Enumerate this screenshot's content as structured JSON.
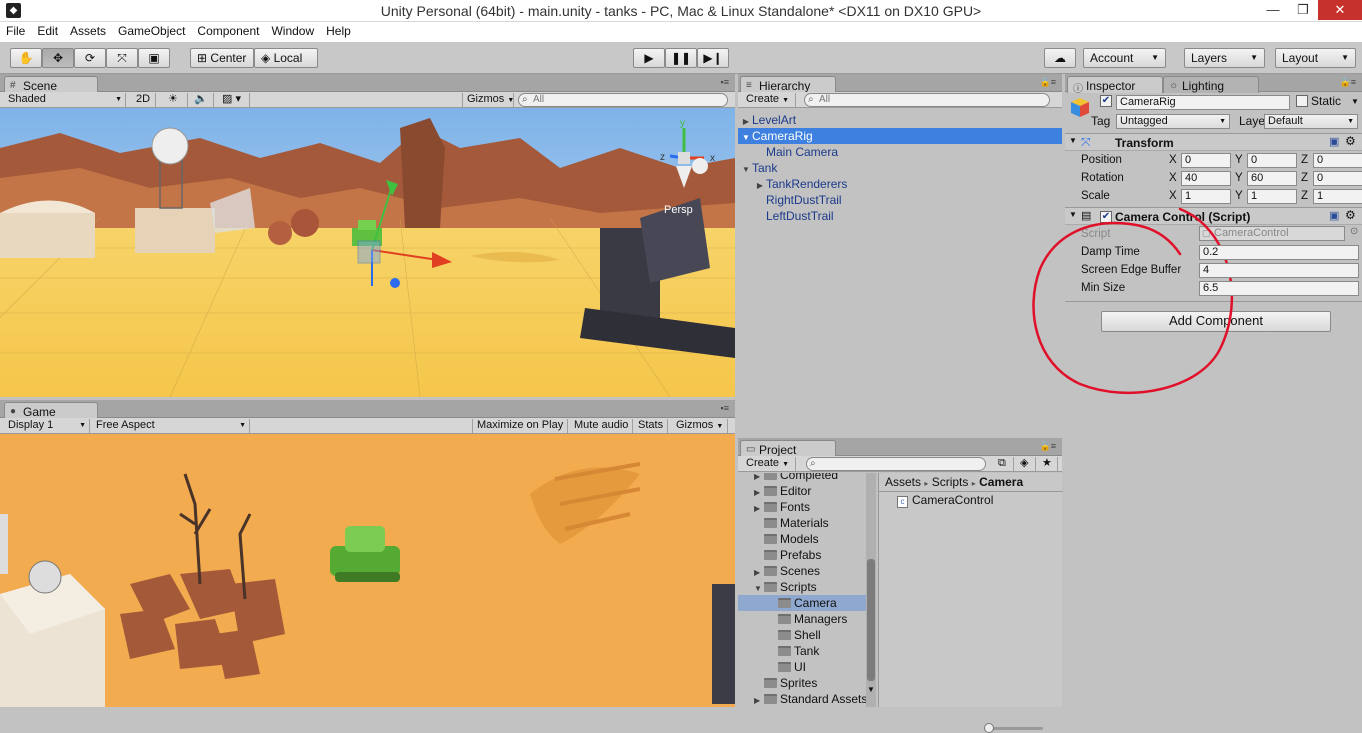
{
  "window": {
    "title": "Unity Personal (64bit) - main.unity - tanks - PC, Mac & Linux Standalone* <DX11 on DX10 GPU>"
  },
  "menu": [
    "File",
    "Edit",
    "Assets",
    "GameObject",
    "Component",
    "Window",
    "Help"
  ],
  "toolbar": {
    "pivot": "Center",
    "space": "Local",
    "account": "Account",
    "layers": "Layers",
    "layout": "Layout"
  },
  "scene": {
    "tab": "Scene",
    "shading": "Shaded",
    "mode2d": "2D",
    "gizmos": "Gizmos",
    "search_placeholder": "All",
    "persp": "Persp"
  },
  "game": {
    "tab": "Game",
    "display": "Display 1",
    "aspect": "Free Aspect",
    "maximize": "Maximize on Play",
    "mute": "Mute audio",
    "stats": "Stats",
    "gizmos": "Gizmos"
  },
  "hierarchy": {
    "tab": "Hierarchy",
    "create": "Create",
    "search_placeholder": "All",
    "items": [
      {
        "label": "LevelArt",
        "depth": 0,
        "arrow": "▶",
        "selected": false
      },
      {
        "label": "CameraRig",
        "depth": 0,
        "arrow": "▼",
        "selected": true
      },
      {
        "label": "Main Camera",
        "depth": 1,
        "arrow": "",
        "selected": false
      },
      {
        "label": "Tank",
        "depth": 0,
        "arrow": "▼",
        "selected": false
      },
      {
        "label": "TankRenderers",
        "depth": 1,
        "arrow": "▶",
        "selected": false
      },
      {
        "label": "RightDustTrail",
        "depth": 1,
        "arrow": "",
        "selected": false
      },
      {
        "label": "LeftDustTrail",
        "depth": 1,
        "arrow": "",
        "selected": false
      }
    ]
  },
  "inspector": {
    "tab": "Inspector",
    "tab2": "Lighting",
    "object_name": "CameraRig",
    "static": "Static",
    "tag_label": "Tag",
    "tag_value": "Untagged",
    "layer_label": "Layer",
    "layer_value": "Default",
    "transform": {
      "title": "Transform",
      "rows": [
        {
          "label": "Position",
          "x": "0",
          "y": "0",
          "z": "0"
        },
        {
          "label": "Rotation",
          "x": "40",
          "y": "60",
          "z": "0"
        },
        {
          "label": "Scale",
          "x": "1",
          "y": "1",
          "z": "1"
        }
      ],
      "axes": [
        "X",
        "Y",
        "Z"
      ]
    },
    "script_comp": {
      "title": "Camera Control (Script)",
      "script_label": "Script",
      "script_value": "CameraControl",
      "fields": [
        {
          "label": "Damp Time",
          "value": "0.2"
        },
        {
          "label": "Screen Edge Buffer",
          "value": "4"
        },
        {
          "label": "Min Size",
          "value": "6.5"
        }
      ]
    },
    "add_component": "Add Component"
  },
  "project": {
    "tab": "Project",
    "create": "Create",
    "folders": [
      {
        "label": "Completed",
        "depth": 1,
        "arrow": "▶"
      },
      {
        "label": "Editor",
        "depth": 1,
        "arrow": "▶"
      },
      {
        "label": "Fonts",
        "depth": 1,
        "arrow": "▶"
      },
      {
        "label": "Materials",
        "depth": 1,
        "arrow": ""
      },
      {
        "label": "Models",
        "depth": 1,
        "arrow": ""
      },
      {
        "label": "Prefabs",
        "depth": 1,
        "arrow": ""
      },
      {
        "label": "Scenes",
        "depth": 1,
        "arrow": "▶"
      },
      {
        "label": "Scripts",
        "depth": 1,
        "arrow": "▼"
      },
      {
        "label": "Camera",
        "depth": 2,
        "arrow": "",
        "selected": true
      },
      {
        "label": "Managers",
        "depth": 2,
        "arrow": ""
      },
      {
        "label": "Shell",
        "depth": 2,
        "arrow": ""
      },
      {
        "label": "Tank",
        "depth": 2,
        "arrow": ""
      },
      {
        "label": "UI",
        "depth": 2,
        "arrow": ""
      },
      {
        "label": "Sprites",
        "depth": 1,
        "arrow": ""
      },
      {
        "label": "Standard Assets",
        "depth": 1,
        "arrow": "▶"
      }
    ],
    "breadcrumb": [
      "Assets",
      "Scripts",
      "Camera"
    ],
    "files": [
      "CameraControl"
    ]
  },
  "colors": {
    "annotation": "#e0102a",
    "selection": "#3d80df"
  }
}
